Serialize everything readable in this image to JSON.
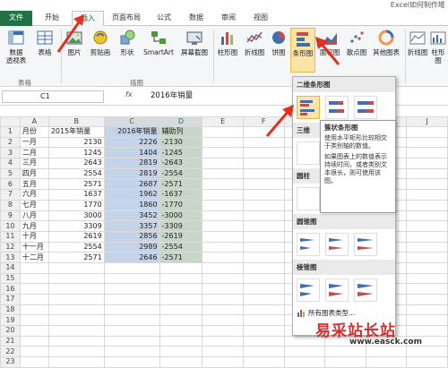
{
  "window": {
    "title": "Excel如何制作堆"
  },
  "tabs": [
    "文件",
    "开始",
    "插入",
    "页面布局",
    "公式",
    "数据",
    "审阅",
    "视图"
  ],
  "ribbon": {
    "buttons": [
      {
        "label": "数据\n透视表",
        "icon": "pivot-table-icon"
      },
      {
        "label": "表格",
        "icon": "table-icon"
      },
      {
        "label": "图片",
        "icon": "picture-icon"
      },
      {
        "label": "剪贴画",
        "icon": "clipart-icon"
      },
      {
        "label": "形状",
        "icon": "shapes-icon"
      },
      {
        "label": "SmartArt",
        "icon": "smartart-icon"
      },
      {
        "label": "屏幕截图",
        "icon": "screenshot-icon"
      },
      {
        "label": "柱形图",
        "icon": "column-chart-icon"
      },
      {
        "label": "折线图",
        "icon": "line-chart-icon"
      },
      {
        "label": "饼图",
        "icon": "pie-chart-icon"
      },
      {
        "label": "条形图",
        "icon": "bar-chart-icon"
      },
      {
        "label": "面积图",
        "icon": "area-chart-icon"
      },
      {
        "label": "散点图",
        "icon": "scatter-chart-icon"
      },
      {
        "label": "其他图表",
        "icon": "other-charts-icon"
      },
      {
        "label": "折线图",
        "icon": "sparkline-line-icon"
      },
      {
        "label": "柱形图",
        "icon": "sparkline-column-icon"
      }
    ],
    "groups": {
      "tables": "表格",
      "illustrations": "插图"
    }
  },
  "formula_bar": {
    "name_box": "C1",
    "fx": "fx",
    "formula": "2016年销量"
  },
  "columns": [
    "A",
    "B",
    "C",
    "D",
    "E",
    "F",
    "G",
    "H",
    "I",
    "J"
  ],
  "rows": [
    {
      "n": "1",
      "a": "月份",
      "b": "2015年销量",
      "c": "2016年销量",
      "d": "辅助列"
    },
    {
      "n": "2",
      "a": "一月",
      "b": "2130",
      "c": "2226",
      "d": "-2130"
    },
    {
      "n": "3",
      "a": "二月",
      "b": "1245",
      "c": "1404",
      "d": "-1245"
    },
    {
      "n": "4",
      "a": "三月",
      "b": "2643",
      "c": "2819",
      "d": "-2643"
    },
    {
      "n": "5",
      "a": "四月",
      "b": "2554",
      "c": "2819",
      "d": "-2554"
    },
    {
      "n": "6",
      "a": "五月",
      "b": "2571",
      "c": "2687",
      "d": "-2571"
    },
    {
      "n": "7",
      "a": "六月",
      "b": "1637",
      "c": "1962",
      "d": "-1637"
    },
    {
      "n": "8",
      "a": "七月",
      "b": "1770",
      "c": "1860",
      "d": "-1770"
    },
    {
      "n": "9",
      "a": "八月",
      "b": "3000",
      "c": "3452",
      "d": "-3000"
    },
    {
      "n": "10",
      "a": "九月",
      "b": "3309",
      "c": "3357",
      "d": "-3309"
    },
    {
      "n": "11",
      "a": "十月",
      "b": "2619",
      "c": "2856",
      "d": "-2619"
    },
    {
      "n": "12",
      "a": "十一月",
      "b": "2554",
      "c": "2989",
      "d": "-2554"
    },
    {
      "n": "13",
      "a": "十二月",
      "b": "2571",
      "c": "2646",
      "d": "-2571"
    },
    {
      "n": "14",
      "a": "",
      "b": "",
      "c": "",
      "d": ""
    },
    {
      "n": "15",
      "a": "",
      "b": "",
      "c": "",
      "d": ""
    },
    {
      "n": "16",
      "a": "",
      "b": "",
      "c": "",
      "d": ""
    },
    {
      "n": "17",
      "a": "",
      "b": "",
      "c": "",
      "d": ""
    },
    {
      "n": "18",
      "a": "",
      "b": "",
      "c": "",
      "d": ""
    },
    {
      "n": "19",
      "a": "",
      "b": "",
      "c": "",
      "d": ""
    },
    {
      "n": "20",
      "a": "",
      "b": "",
      "c": "",
      "d": ""
    },
    {
      "n": "21",
      "a": "",
      "b": "",
      "c": "",
      "d": ""
    },
    {
      "n": "22",
      "a": "",
      "b": "",
      "c": "",
      "d": ""
    },
    {
      "n": "23",
      "a": "",
      "b": "",
      "c": "",
      "d": ""
    }
  ],
  "dropdown": {
    "section1": "二维条形图",
    "section2": "三维",
    "section3": "圆柱",
    "section4": "圆锥图",
    "section5": "棱锥图",
    "all_charts": "所有图表类型..."
  },
  "tooltip": {
    "title": "簇状条形图",
    "p1": "使用水平矩形比较相交于类别轴的数值。",
    "p2": "如果图表上的数值表示持续时间，或者类别文本很长，则可使用该图。"
  },
  "watermark": {
    "text": "易采站长站",
    "url": "www.easck.com"
  },
  "colors": {
    "excel_green": "#217346",
    "highlight": "#fce4a5",
    "selection": "#c5d3e8",
    "arrow": "#e0301e"
  }
}
